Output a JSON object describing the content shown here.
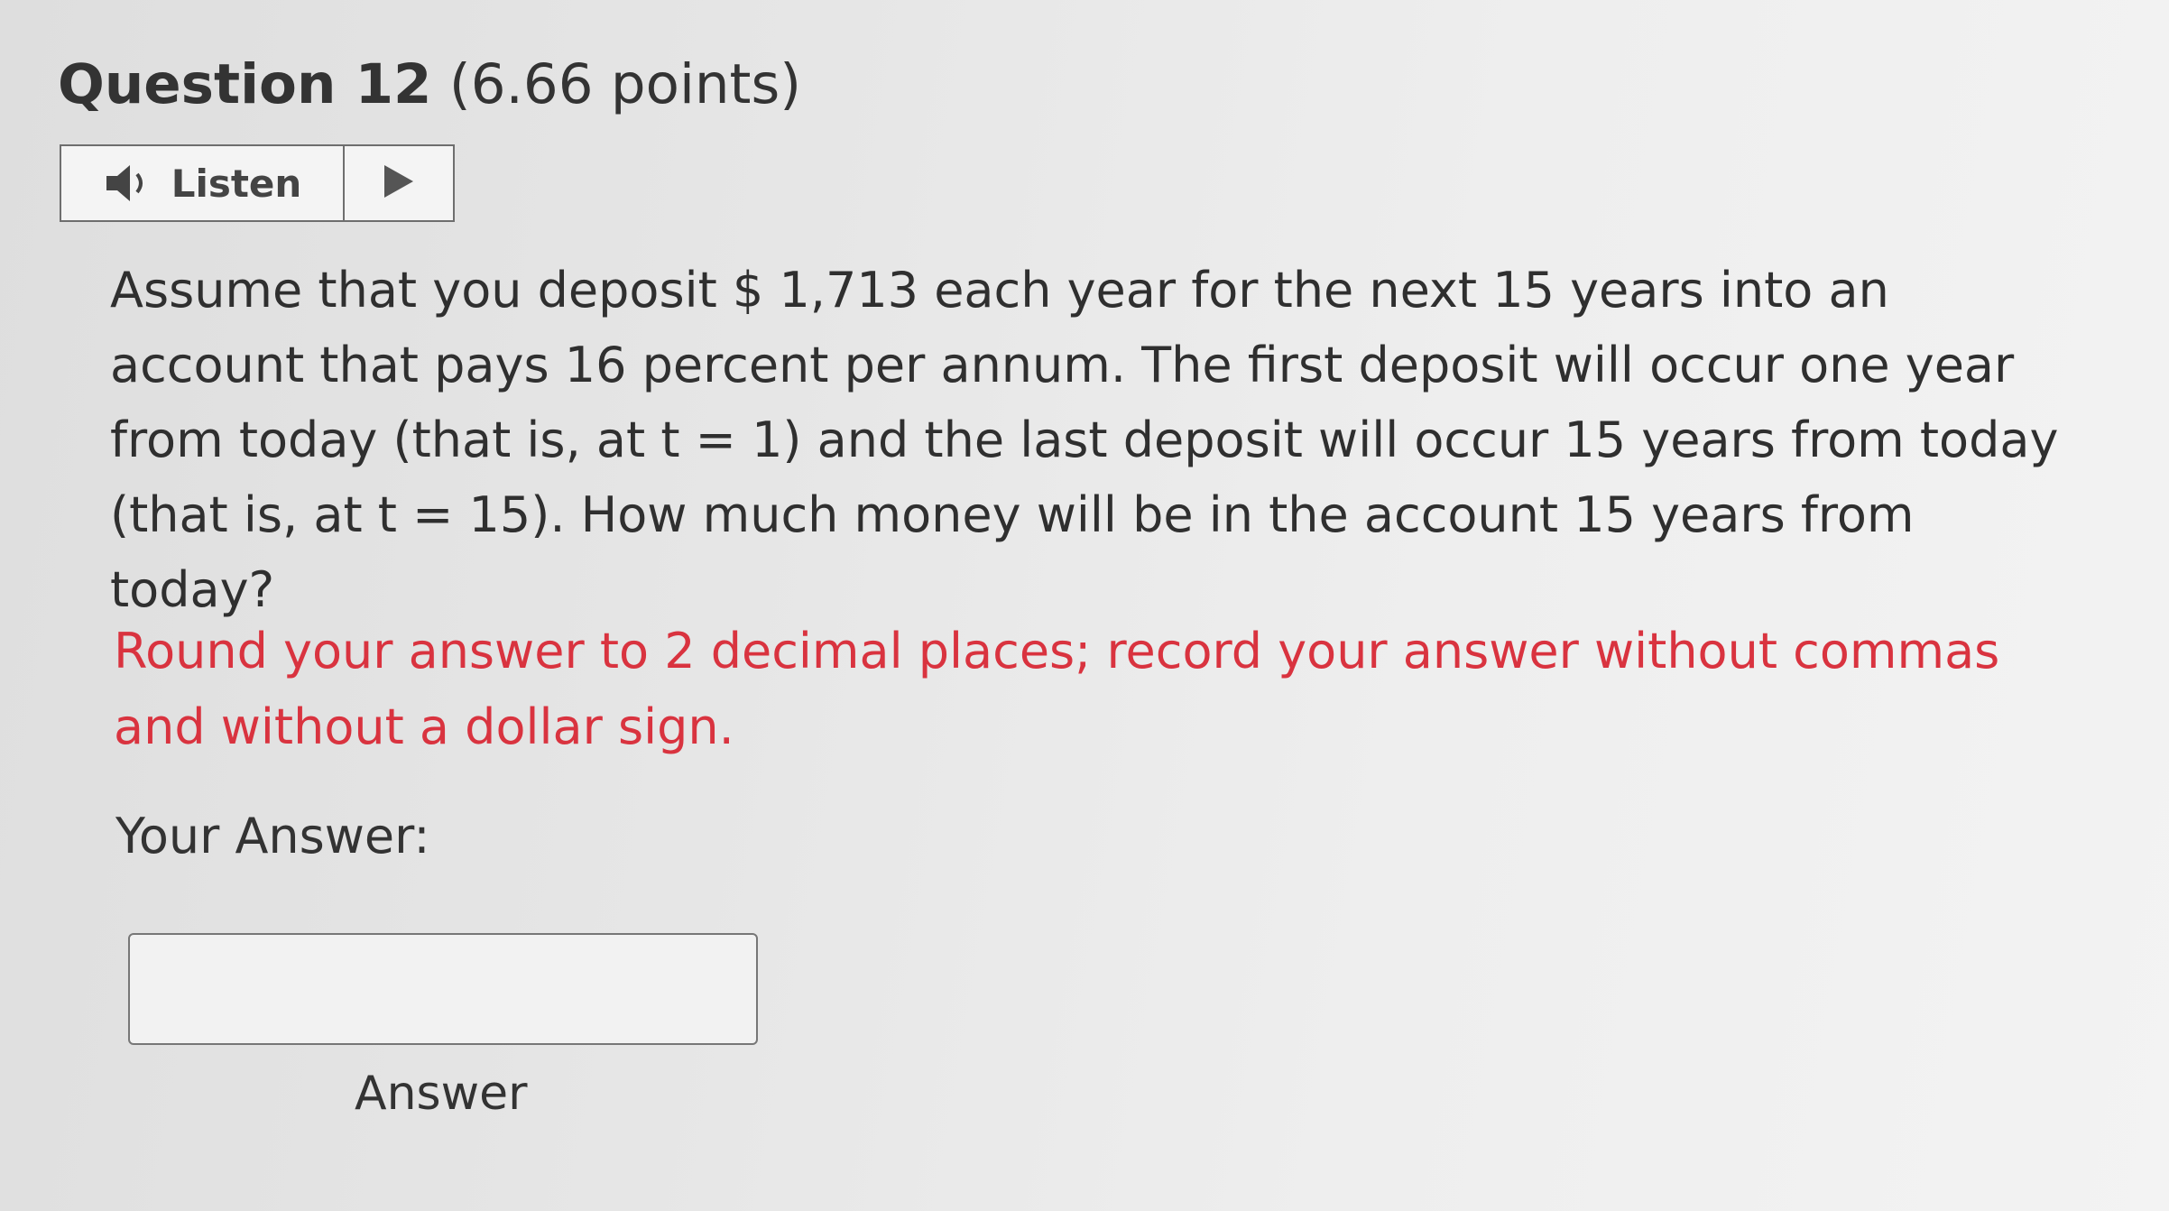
{
  "question": {
    "title": "Question 12",
    "points": "(6.66 points)"
  },
  "listen": {
    "label": "Listen"
  },
  "body": {
    "text": "Assume that you deposit $ 1,713 each year for the next 15 years into an account that pays 16 percent per annum. The first deposit will occur one year from today (that is, at t = 1) and the last deposit will occur 15 years from today (that is, at t = 15). How much money will be in the account 15 years from today?",
    "instructions": "Round your answer to 2 decimal places; record your answer without commas and without a dollar sign."
  },
  "answer": {
    "label": "Your Answer:",
    "value": "",
    "caption": "Answer"
  },
  "colors": {
    "instruction_red": "#d9333f",
    "text": "#333333"
  },
  "icons": {
    "speaker": "speaker-icon",
    "play": "play-icon"
  }
}
